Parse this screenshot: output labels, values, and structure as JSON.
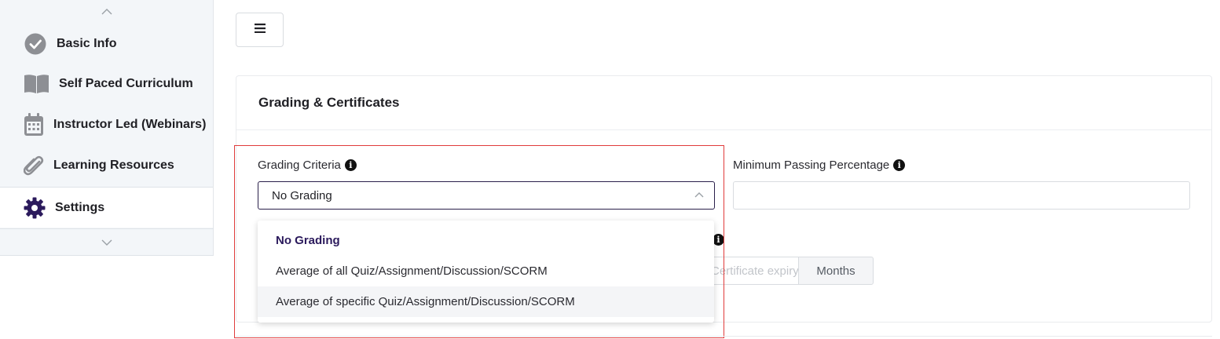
{
  "sidebar": {
    "items": [
      {
        "label": "Basic Info",
        "icon": "check-circle-icon"
      },
      {
        "label": "Self Paced Curriculum",
        "icon": "book-icon"
      },
      {
        "label": "Instructor Led (Webinars)",
        "icon": "calendar-icon"
      },
      {
        "label": "Learning Resources",
        "icon": "paperclip-icon"
      },
      {
        "label": "Settings",
        "icon": "gear-icon",
        "active": true
      }
    ]
  },
  "card": {
    "title": "Grading & Certificates"
  },
  "grading": {
    "label": "Grading Criteria",
    "selected": "No Grading",
    "options": [
      "No Grading",
      "Average of all Quiz/Assignment/Discussion/SCORM",
      "Average of specific Quiz/Assignment/Discussion/SCORM"
    ]
  },
  "min_passing": {
    "label": "Minimum Passing Percentage",
    "value": ""
  },
  "expiry": {
    "placeholder": "Certificate expiry",
    "unit": "Months"
  },
  "colors": {
    "accent": "#2b1a5c",
    "highlight": "#e03c3c",
    "sidebar_bg": "#f3f6f9"
  }
}
